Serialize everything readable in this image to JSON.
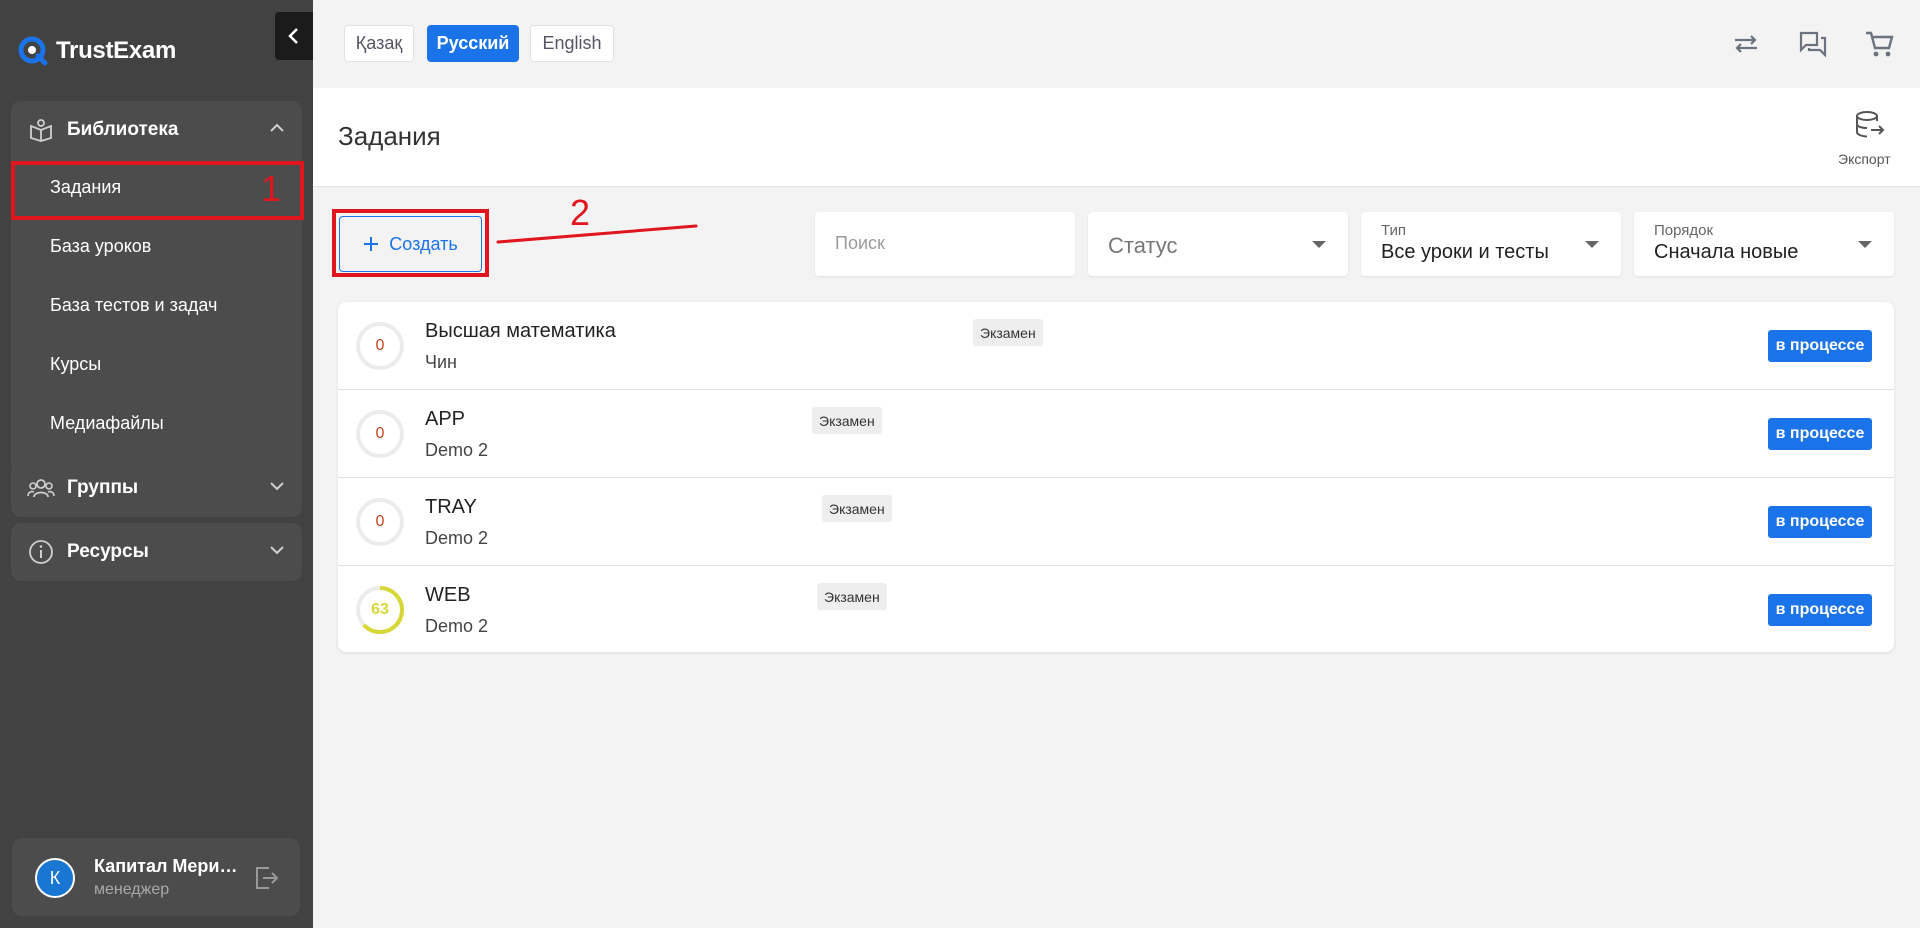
{
  "brand": {
    "name": "TrustExam"
  },
  "sidebar": {
    "groups": [
      {
        "label": "Библиотека",
        "icon": "book-icon",
        "items": [
          "Задания",
          "База уроков",
          "База тестов и задач",
          "Курсы",
          "Медиафайлы"
        ]
      },
      {
        "label": "Группы",
        "icon": "people-icon"
      },
      {
        "label": "Ресурсы",
        "icon": "info-icon"
      }
    ],
    "active_item": "Задания"
  },
  "user": {
    "initial": "К",
    "name": "Капитал Меридиан",
    "role": "менеджер"
  },
  "languages": [
    {
      "label": "Қазақ",
      "active": false
    },
    {
      "label": "Русский",
      "active": true
    },
    {
      "label": "English",
      "active": false
    }
  ],
  "topbar_icons": [
    "swap-icon",
    "chat-icon",
    "cart-icon"
  ],
  "page": {
    "title": "Задания",
    "export_label": "Экспорт"
  },
  "toolbar": {
    "create_label": "Создать",
    "search_placeholder": "Поиск",
    "status_placeholder": "Статус",
    "type_label": "Тип",
    "type_value": "Все уроки и тесты",
    "order_label": "Порядок",
    "order_value": "Сначала новые"
  },
  "annotations": {
    "one": "1",
    "two": "2"
  },
  "tasks": [
    {
      "score": "0",
      "score_fraction": 0,
      "title": "Высшая математика",
      "badge": "Экзамен",
      "subtitle": "Чин",
      "status": "в процессе"
    },
    {
      "score": "0",
      "score_fraction": 0,
      "title": "APP",
      "badge": "Экзамен",
      "subtitle": "Demo 2",
      "status": "в процессе"
    },
    {
      "score": "0",
      "score_fraction": 0,
      "title": "TRAY",
      "badge": "Экзамен",
      "subtitle": "Demo 2",
      "status": "в процессе"
    },
    {
      "score": "63",
      "score_fraction": 0.63,
      "title": "WEB",
      "badge": "Экзамен",
      "subtitle": "Demo 2",
      "status": "в процессе"
    }
  ],
  "colors": {
    "accent": "#1a73e8",
    "sidebar": "#424242",
    "annotation": "#e0151d",
    "score_high": "#d6d838",
    "score_zero": "#c0461d"
  }
}
